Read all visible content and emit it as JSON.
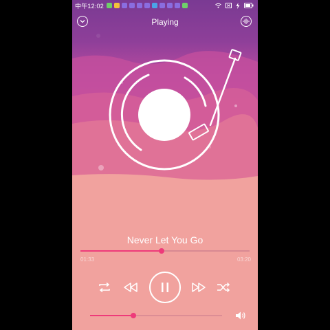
{
  "status_bar": {
    "time": "中午12:02",
    "notification_colors": [
      "#6fcf6a",
      "#f2c23a",
      "#8a6de0",
      "#8a6de0",
      "#8a6de0",
      "#8a6de0",
      "#4aa3e8",
      "#8a6de0",
      "#8a6de0",
      "#8a6de0",
      "#6fcf6a"
    ]
  },
  "header": {
    "title": "Playing"
  },
  "player": {
    "song_title": "Never Let You Go",
    "current_time": "01:33",
    "total_time": "03:20",
    "progress": 0.48,
    "volume": 0.33
  },
  "icons": {
    "back": "chevron-down-icon",
    "equalizer": "sound-wave-icon",
    "repeat": "repeat-icon",
    "previous": "rewind-icon",
    "pause": "pause-icon",
    "next": "fast-forward-icon",
    "shuffle": "shuffle-icon",
    "volume": "volume-icon"
  },
  "colors": {
    "accent": "#ee3a7a",
    "background_top": "#7a3a93",
    "background_bottom": "#f9c0a8"
  }
}
